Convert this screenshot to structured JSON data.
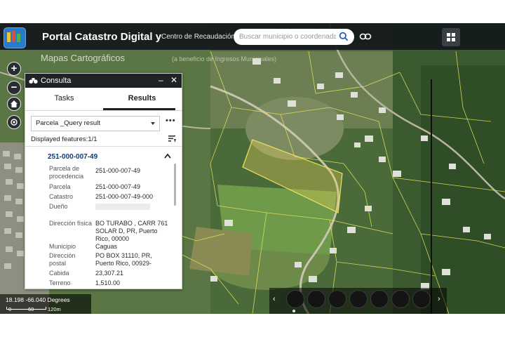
{
  "header": {
    "title": "Portal Catastro Digital y",
    "subtitle": "Centro de Recaudación de",
    "search_placeholder": "Buscar municipio o coordenada"
  },
  "map": {
    "layer_label": "Mapas Cartográficos",
    "layer_label_secondary": "(a beneficio de Ingresos Municipales)"
  },
  "map_controls": {
    "zoom_in": "+",
    "zoom_out": "−"
  },
  "panel": {
    "title": "Consulta",
    "tabs": [
      {
        "label": "Tasks",
        "active": false
      },
      {
        "label": "Results",
        "active": true
      }
    ],
    "query_select": "Parcela _Query result",
    "more_label": "•••",
    "displayed_features": "Displayed features:1/1",
    "result": {
      "id": "251-000-007-49",
      "attributes": [
        {
          "label": "Parcela de procedencia",
          "value": "251-000-007-49"
        },
        {
          "label": "Parcela",
          "value": "251-000-007-49"
        },
        {
          "label": "Catastro",
          "value": "251-000-007-49-000"
        },
        {
          "label": "Dueño",
          "value": ""
        },
        {
          "label": "Dirección física",
          "value": "BO TURABO , CARR 761 SOLAR D, PR, Puerto Rico, 00000"
        },
        {
          "label": "Municipio",
          "value": "Caguas"
        },
        {
          "label": "Dirección postal",
          "value": "PO BOX 31110, PR, Puerto Rico, 00929-"
        },
        {
          "label": "Cabida",
          "value": "23,307.21"
        },
        {
          "label": "Terreno",
          "value": "1,510.00"
        }
      ]
    }
  },
  "status_bar": {
    "coordinates": "18.198  -66.040 Degrees",
    "scale_labels": [
      "0",
      "60",
      "120m"
    ]
  },
  "colors": {
    "header_bg": "#14181c",
    "panel_header": "#1f2326",
    "link_blue": "#0c3c7c",
    "parcel_highlight": "#e8d25a",
    "parcel_outline": "#ece65c"
  }
}
